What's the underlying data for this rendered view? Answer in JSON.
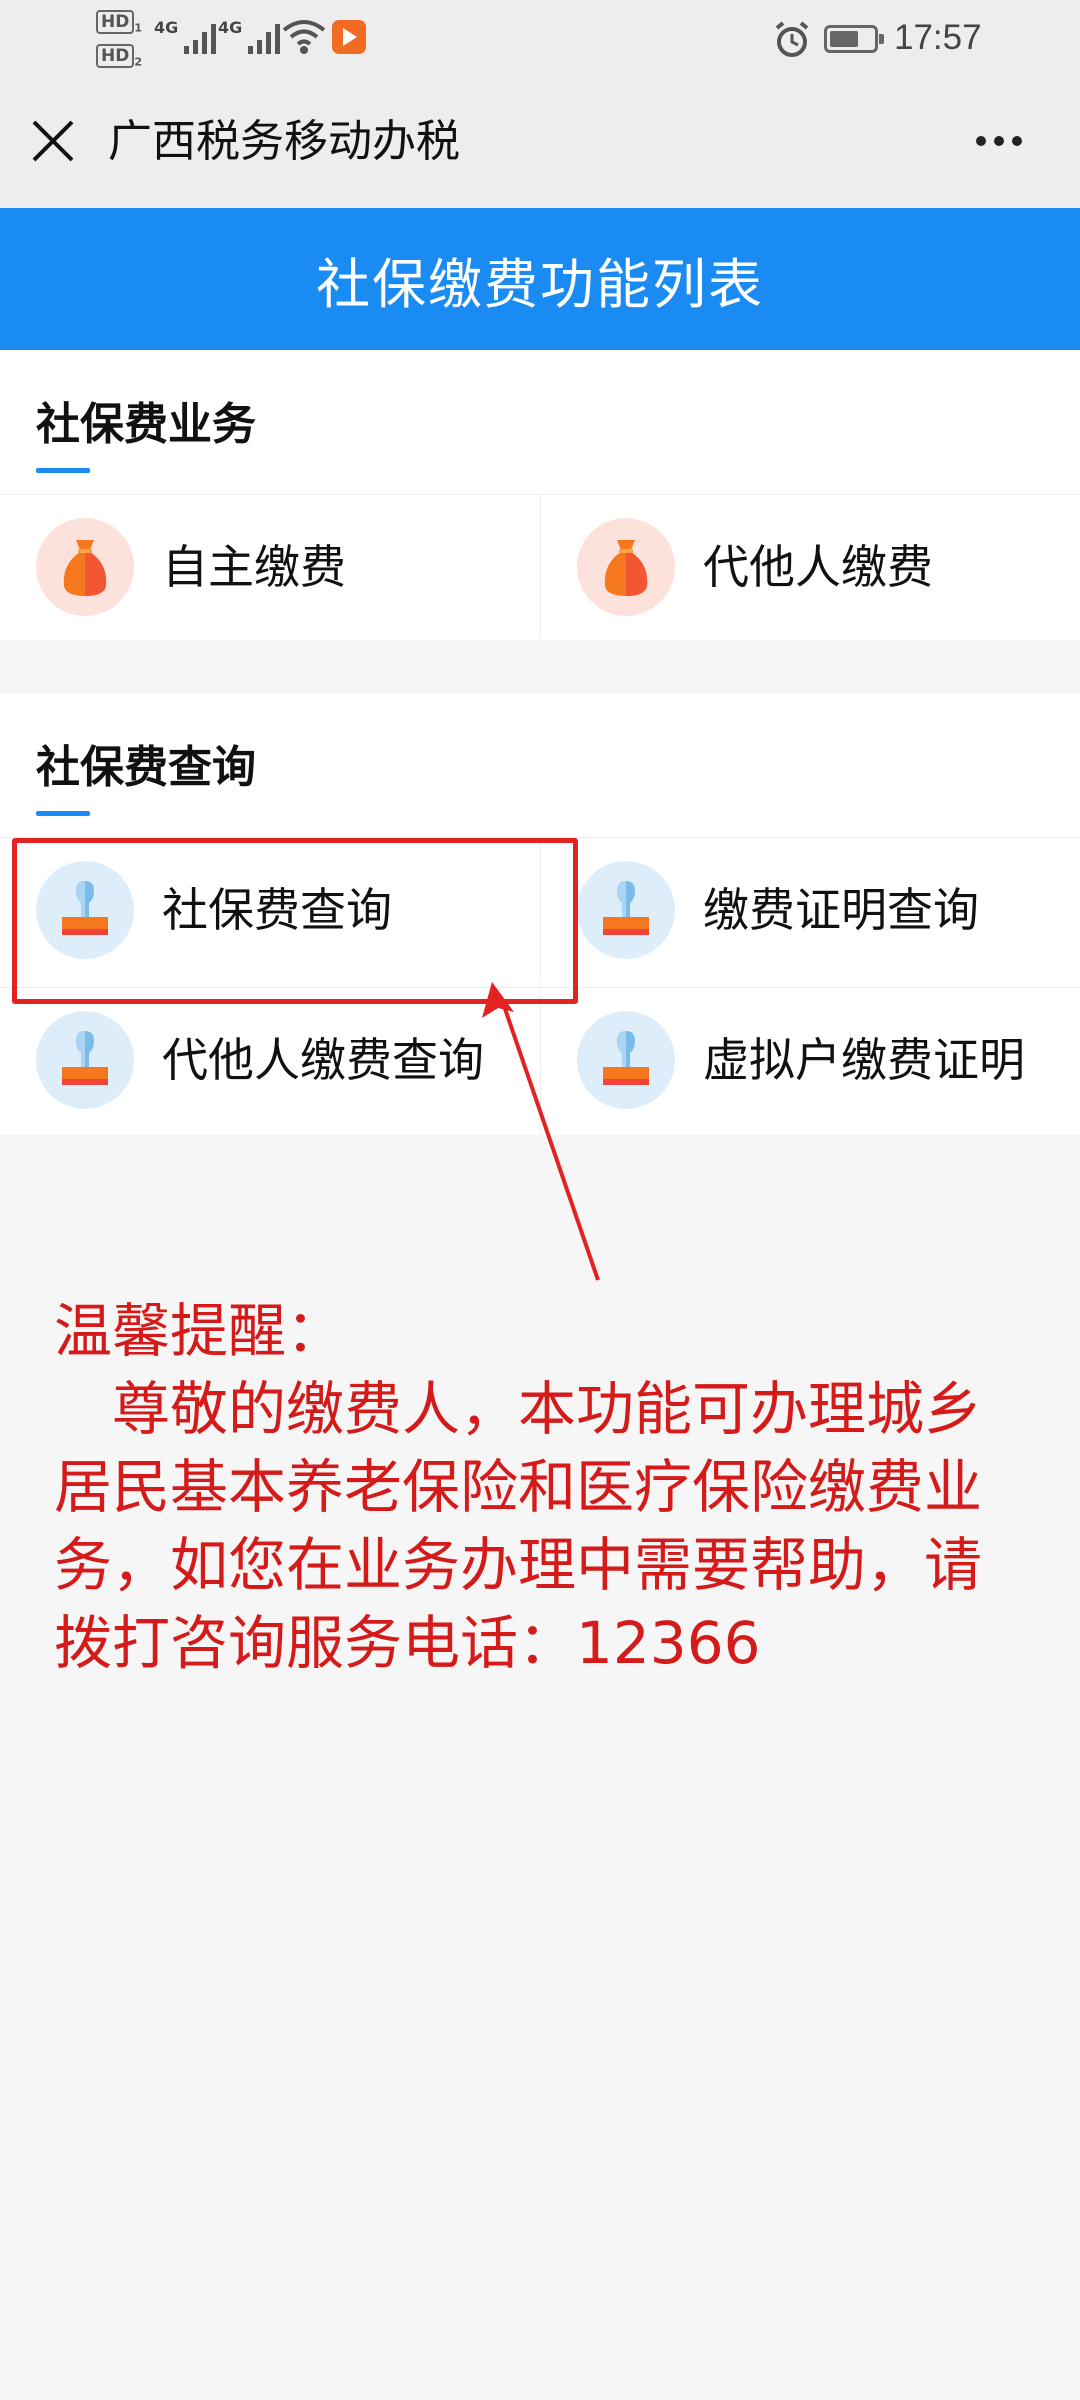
{
  "status_bar": {
    "hd1": "HD",
    "hd2": "HD",
    "network1": "4G",
    "network2": "4G",
    "time": "17:57"
  },
  "nav": {
    "title": "广西税务移动办税"
  },
  "header": {
    "title": "社保缴费功能列表"
  },
  "sections": [
    {
      "title": "社保费业务",
      "items": [
        {
          "label": "自主缴费",
          "icon": "money-bag-icon"
        },
        {
          "label": "代他人缴费",
          "icon": "money-bag-icon"
        }
      ]
    },
    {
      "title": "社保费查询",
      "items": [
        {
          "label": "社保费查询",
          "icon": "stamp-icon"
        },
        {
          "label": "缴费证明查询",
          "icon": "stamp-icon"
        },
        {
          "label": "代他人缴费查询",
          "icon": "stamp-icon"
        },
        {
          "label": "虚拟户缴费证明",
          "icon": "stamp-icon"
        }
      ]
    }
  ],
  "notice": {
    "title": "温馨提醒：",
    "body": "尊敬的缴费人，本功能可办理城乡居民基本养老保险和医疗保险缴费业务，如您在业务办理中需要帮助，请拨打咨询服务电话：12366"
  },
  "colors": {
    "primary": "#1a8bf3",
    "annotation": "#e32222",
    "notice_text": "#d51a1a"
  }
}
